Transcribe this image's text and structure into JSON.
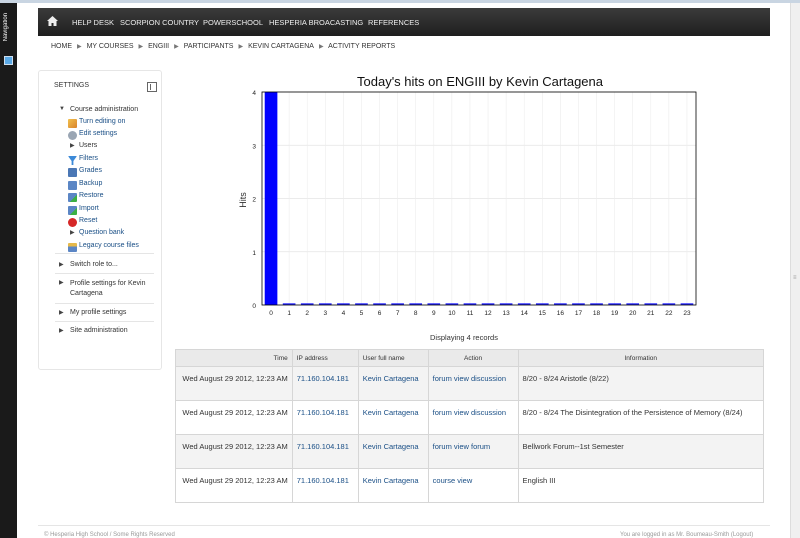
{
  "side_panel": {
    "label": "Navigation"
  },
  "navbar": {
    "items": [
      "HELP DESK",
      "SCORPION COUNTRY",
      "POWERSCHOOL",
      "HESPERIA BROACASTING",
      "REFERENCES"
    ]
  },
  "breadcrumb": [
    "HOME",
    "MY COURSES",
    "ENGIII",
    "PARTICIPANTS",
    "KEVIN CARTAGENA",
    "ACTIVITY REPORTS"
  ],
  "settings": {
    "title": "SETTINGS",
    "course_admin": "Course administration",
    "items": [
      "Turn editing on",
      "Edit settings",
      "Users",
      "Filters",
      "Grades",
      "Backup",
      "Restore",
      "Import",
      "Reset",
      "Question bank",
      "Legacy course files"
    ],
    "switch_role": "Switch role to...",
    "profile_settings": "Profile settings for Kevin Cartagena",
    "my_profile": "My profile settings",
    "site_admin": "Site administration"
  },
  "chart_data": {
    "type": "bar",
    "title": "Today's hits on ENGIII by Kevin Cartagena",
    "ylabel": "Hits",
    "xlabel": "",
    "categories": [
      "0",
      "1",
      "2",
      "3",
      "4",
      "5",
      "6",
      "7",
      "8",
      "9",
      "10",
      "11",
      "12",
      "13",
      "14",
      "15",
      "16",
      "17",
      "18",
      "19",
      "20",
      "21",
      "22",
      "23"
    ],
    "values": [
      4,
      0,
      0,
      0,
      0,
      0,
      0,
      0,
      0,
      0,
      0,
      0,
      0,
      0,
      0,
      0,
      0,
      0,
      0,
      0,
      0,
      0,
      0,
      0
    ],
    "ylim": [
      0,
      4
    ],
    "yticks": [
      "0",
      "1",
      "2",
      "3",
      "4"
    ],
    "bar_color": "#0000ff",
    "grid": true
  },
  "records": "Displaying 4 records",
  "table": {
    "headers": [
      "Time",
      "IP address",
      "User full name",
      "Action",
      "Information"
    ],
    "rows": [
      {
        "time": "Wed August 29 2012, 12:23 AM",
        "ip": "71.160.104.181",
        "user": "Kevin Cartagena",
        "action": "forum view discussion",
        "info": "8/20 - 8/24 Aristotle (8/22)"
      },
      {
        "time": "Wed August 29 2012, 12:23 AM",
        "ip": "71.160.104.181",
        "user": "Kevin Cartagena",
        "action": "forum view discussion",
        "info": "8/20 - 8/24 The Disintegration of the Persistence of Memory (8/24)"
      },
      {
        "time": "Wed August 29 2012, 12:23 AM",
        "ip": "71.160.104.181",
        "user": "Kevin Cartagena",
        "action": "forum view forum",
        "info": "Bellwork Forum--1st Semester"
      },
      {
        "time": "Wed August 29 2012, 12:23 AM",
        "ip": "71.160.104.181",
        "user": "Kevin Cartagena",
        "action": "course view",
        "info": "English III"
      }
    ]
  },
  "footer": {
    "left": "© Hesperia High School / Some Rights Reserved",
    "right": "You are logged in as Mr. Boumeau-Smith (Logout)"
  }
}
